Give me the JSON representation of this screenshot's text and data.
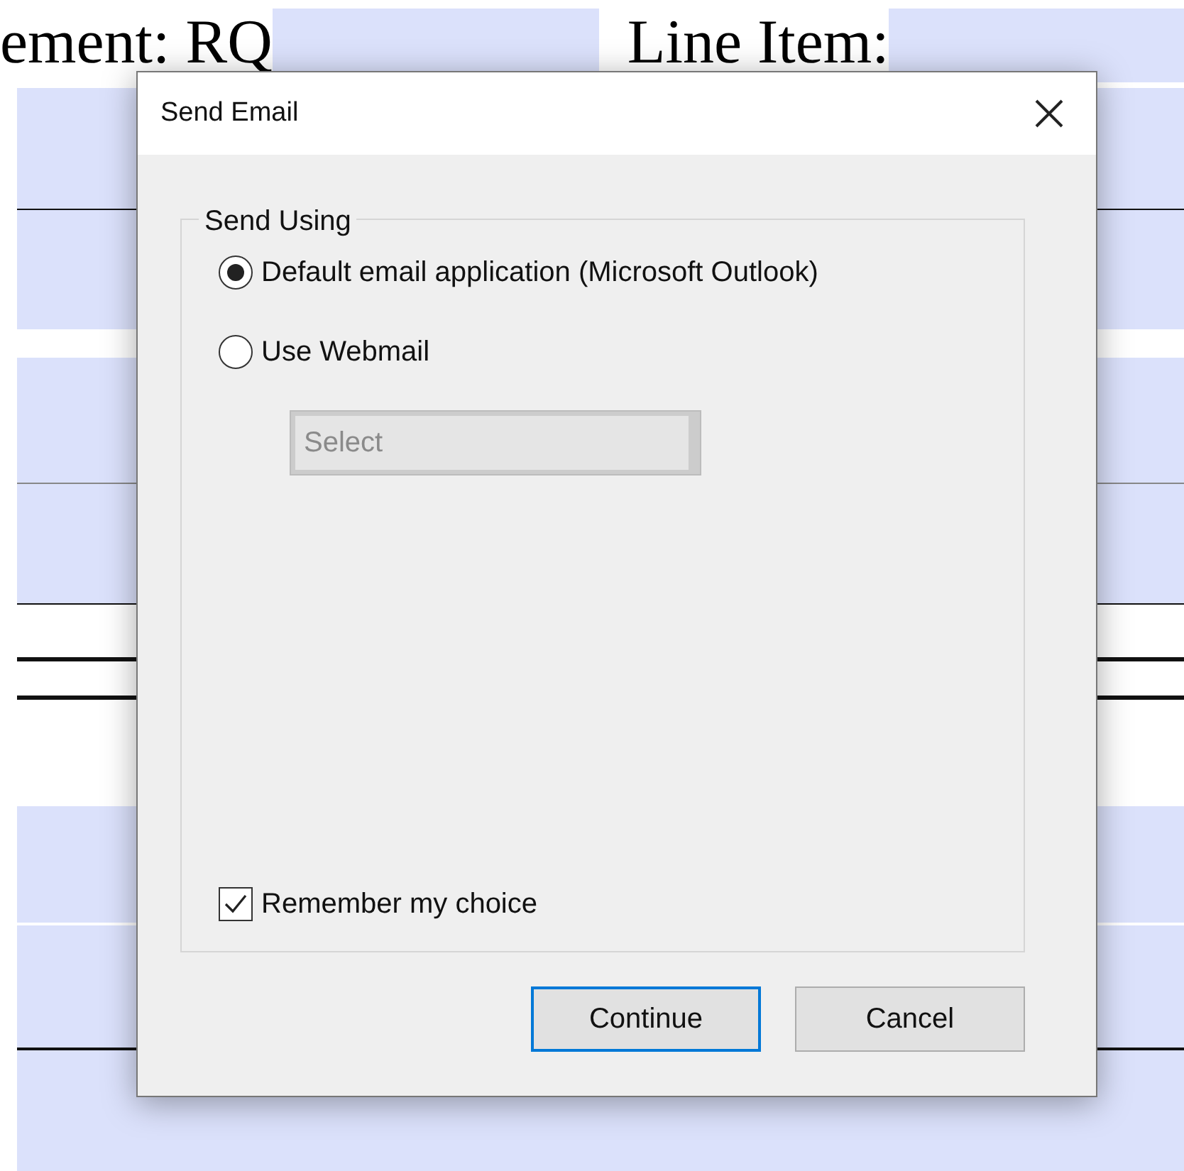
{
  "page": {
    "labels": [
      "ement: RQ",
      "Line Item:"
    ]
  },
  "dialog": {
    "title": "Send Email",
    "group": {
      "title": "Send Using",
      "options": [
        {
          "label": "Default email application (Microsoft Outlook)",
          "selected": true
        },
        {
          "label": "Use Webmail",
          "selected": false
        }
      ],
      "dropdown": {
        "placeholder": "Select",
        "disabled": true
      },
      "checkbox": {
        "label": "Remember my choice",
        "checked": true
      }
    },
    "buttons": [
      {
        "label": "Continue",
        "default": true
      },
      {
        "label": "Cancel",
        "default": false
      }
    ]
  }
}
